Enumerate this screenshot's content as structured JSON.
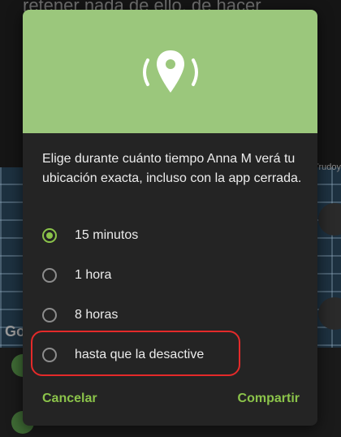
{
  "background": {
    "text": "retener nada de ello, de hacer",
    "map_attribution": "Go",
    "map_attribution_right": "Trudoy"
  },
  "dialog": {
    "message": "Elige durante cuánto tiempo Anna M verá tu ubicación exacta, incluso con la app cerrada.",
    "options": [
      {
        "label": "15 minutos",
        "selected": true
      },
      {
        "label": "1 hora",
        "selected": false
      },
      {
        "label": "8 horas",
        "selected": false
      },
      {
        "label": "hasta que la desactive",
        "selected": false
      }
    ],
    "cancel_label": "Cancelar",
    "share_label": "Compartir"
  },
  "colors": {
    "header_bg": "#9bc77c",
    "accent": "#8bc34a",
    "dialog_bg": "#242424",
    "highlight": "#e42a2a"
  }
}
